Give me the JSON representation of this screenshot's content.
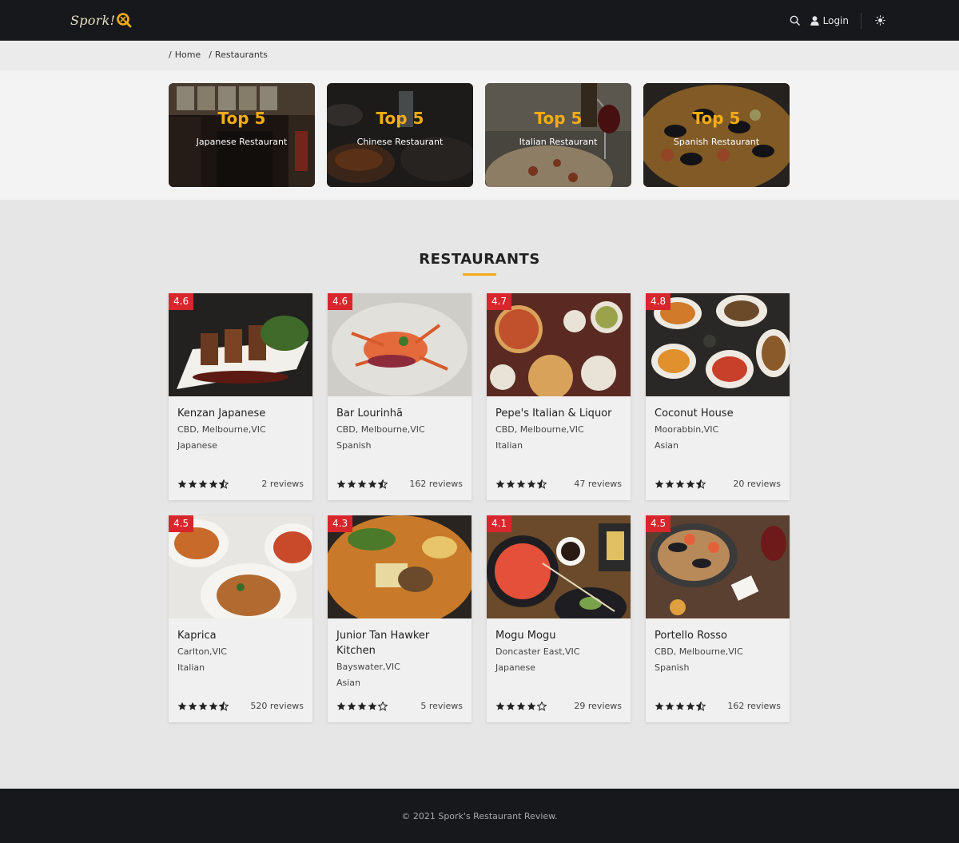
{
  "brand": {
    "logo_text": "Spork!",
    "logo_mark": "Q"
  },
  "nav": {
    "login_label": "Login",
    "search_icon": "search-icon",
    "user_icon": "user-icon",
    "theme_icon": "sun-icon"
  },
  "breadcrumb": {
    "items": [
      "Home",
      "Restaurants"
    ]
  },
  "top5": [
    {
      "title": "Top 5",
      "subtitle": "Japanese Restaurant"
    },
    {
      "title": "Top 5",
      "subtitle": "Chinese Restaurant"
    },
    {
      "title": "Top 5",
      "subtitle": "Italian Restaurant"
    },
    {
      "title": "Top 5",
      "subtitle": "Spanish Restaurant"
    }
  ],
  "section": {
    "title": "RESTAURANTS"
  },
  "restaurants": [
    {
      "rating": "4.6",
      "name": "Kenzan Japanese",
      "location": "CBD, Melbourne,VIC",
      "cuisine": "Japanese",
      "stars": 4.5,
      "reviews": "2 reviews"
    },
    {
      "rating": "4.6",
      "name": "Bar Lourinhã",
      "location": "CBD, Melbourne,VIC",
      "cuisine": "Spanish",
      "stars": 4.5,
      "reviews": "162 reviews"
    },
    {
      "rating": "4.7",
      "name": "Pepe's Italian & Liquor",
      "location": "CBD, Melbourne,VIC",
      "cuisine": "Italian",
      "stars": 4.5,
      "reviews": "47 reviews"
    },
    {
      "rating": "4.8",
      "name": "Coconut House",
      "location": "Moorabbin,VIC",
      "cuisine": "Asian",
      "stars": 4.5,
      "reviews": "20 reviews"
    },
    {
      "rating": "4.5",
      "name": "Kaprica",
      "location": "Carlton,VIC",
      "cuisine": "Italian",
      "stars": 4.5,
      "reviews": "520 reviews"
    },
    {
      "rating": "4.3",
      "name": "Junior Tan Hawker Kitchen",
      "location": "Bayswater,VIC",
      "cuisine": "Asian",
      "stars": 4,
      "reviews": "5 reviews"
    },
    {
      "rating": "4.1",
      "name": "Mogu Mogu",
      "location": "Doncaster East,VIC",
      "cuisine": "Japanese",
      "stars": 4,
      "reviews": "29 reviews"
    },
    {
      "rating": "4.5",
      "name": "Portello Rosso",
      "location": "CBD, Melbourne,VIC",
      "cuisine": "Spanish",
      "stars": 4.5,
      "reviews": "162 reviews"
    }
  ],
  "footer": {
    "text": "© 2021 Spork's Restaurant Review."
  },
  "colors": {
    "accent": "#f5ab17",
    "rating_badge": "#d8262c",
    "header_bg": "#16181b"
  }
}
